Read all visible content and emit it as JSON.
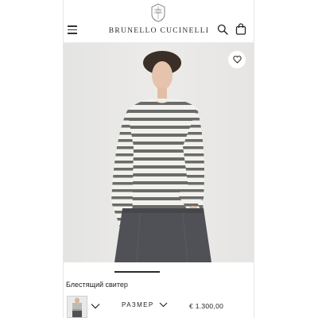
{
  "header": {
    "brand": "BRUNELLO CUCINELLI",
    "icons": [
      "menu-icon",
      "crest-logo",
      "search-icon",
      "shopping-bag-icon"
    ]
  },
  "product": {
    "name": "Блестящий свитер",
    "size_label": "РАЗМЕР",
    "price": "€ 1.300,00",
    "favorite_icon": "heart-icon",
    "gallery_position": 0.35,
    "colors": {
      "stripe_dark": "#6a6c6c",
      "stripe_light": "#f3f1ec",
      "skirt": "#4f5156",
      "background": "#e8e7e5"
    }
  }
}
